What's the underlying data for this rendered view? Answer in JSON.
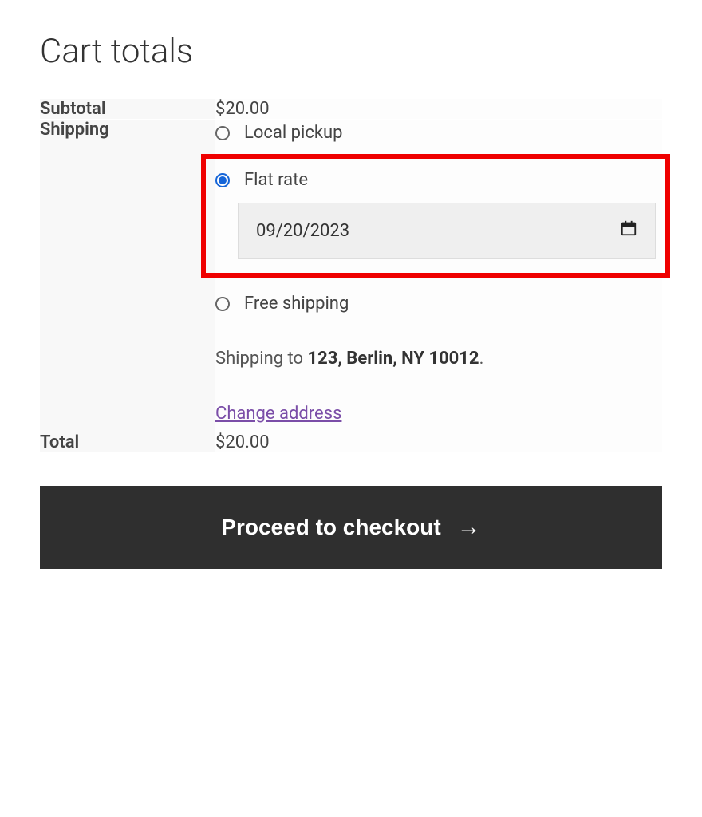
{
  "title": "Cart totals",
  "rows": {
    "subtotal": {
      "label": "Subtotal",
      "value": "$20.00"
    },
    "shipping": {
      "label": "Shipping"
    },
    "total": {
      "label": "Total",
      "value": "$20.00"
    }
  },
  "shipping": {
    "options": {
      "local_pickup": "Local pickup",
      "flat_rate": "Flat rate",
      "free_shipping": "Free shipping"
    },
    "date_value": "09/20/2023",
    "to_prefix": "Shipping to ",
    "to_address": "123, Berlin, NY 10012",
    "to_suffix": ".",
    "change_address": "Change address"
  },
  "checkout_button": "Proceed to checkout"
}
